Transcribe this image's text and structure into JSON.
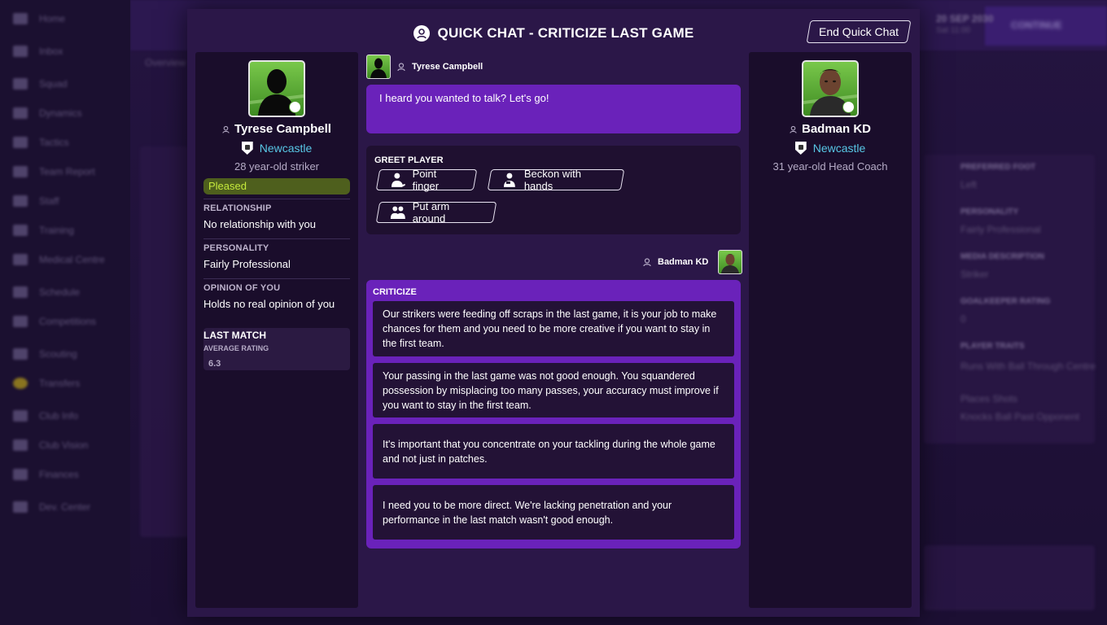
{
  "modal": {
    "title": "QUICK CHAT - CRITICIZE LAST GAME",
    "end_button": "End Quick Chat"
  },
  "player": {
    "name": "Tyrese Campbell",
    "club": "Newcastle",
    "age_role": "28 year-old striker",
    "mood": "Pleased",
    "relationship_label": "RELATIONSHIP",
    "relationship_value": "No relationship with you",
    "personality_label": "PERSONALITY",
    "personality_value": "Fairly Professional",
    "opinion_label": "OPINION OF YOU",
    "opinion_value": "Holds no real opinion of you",
    "last_match_label": "LAST MATCH",
    "avg_rating_label": "AVERAGE RATING",
    "avg_rating_value": "6.3"
  },
  "coach": {
    "name": "Badman KD",
    "club": "Newcastle",
    "age_role": "31 year-old Head Coach"
  },
  "chat": {
    "player_name": "Tyrese Campbell",
    "player_message": "I heard you wanted to talk? Let's go!",
    "greet_title": "GREET PLAYER",
    "greet_options": [
      "Point finger",
      "Beckon with hands",
      "Put arm around"
    ],
    "coach_name": "Badman KD",
    "criticize_title": "CRITICIZE",
    "criticize_options": [
      "Our strikers were feeding off scraps in the last game, it is your job to make chances for them and you need to be more creative if you want to stay in the first team.",
      "Your passing in the last game was not good enough. You squandered possession by misplacing too many passes, your accuracy must improve if you want to stay in the first team.",
      "It's important that you concentrate on your tackling during the whole game and not just in patches.",
      "I need you to be more direct. We're lacking penetration and your performance in the last match wasn't good enough."
    ]
  },
  "background": {
    "nav_items": [
      "Home",
      "Inbox",
      "Squad",
      "Dynamics",
      "Tactics",
      "Team Report",
      "Staff",
      "Training",
      "Medical Centre",
      "Schedule",
      "Competitions",
      "Scouting",
      "Transfers",
      "Club Info",
      "Club Vision",
      "Finances",
      "Dev. Center"
    ],
    "date": "20 SEP 2030",
    "date_sub": "Sat 11:00",
    "continue_label": "CONTINUE",
    "overview_tab": "Overview",
    "right_labels": [
      "PREFERRED FOOT",
      "Left",
      "PERSONALITY",
      "Fairly Professional",
      "MEDIA DESCRIPTION",
      "Striker",
      "GOALKEEPER RATING",
      "0",
      "PLAYER TRAITS",
      "Runs With Ball Through Centre",
      "Places Shots",
      "Knocks Ball Past Opponent"
    ]
  },
  "colors": {
    "modal_bg": "#2b1748",
    "panel_bg": "#1a0d2b",
    "accent_purple": "#6a22ba",
    "club_link": "#58c7e6",
    "mood_bg": "#4e5f1d",
    "mood_text": "#c5ea3c"
  },
  "icons": {
    "title": "quick-chat-icon",
    "person": "person-icon",
    "club": "club-crest-icon",
    "gestures": [
      "point-finger-icon",
      "beckon-hands-icon",
      "arm-around-icon"
    ]
  }
}
